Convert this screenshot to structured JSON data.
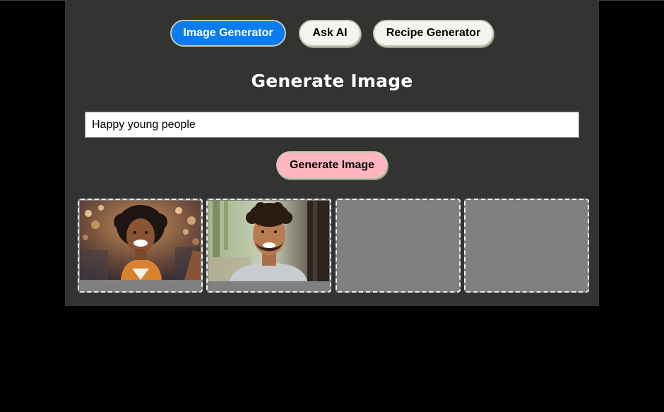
{
  "nav": {
    "items": [
      {
        "label": "Image Generator",
        "active": true
      },
      {
        "label": "Ask AI",
        "active": false
      },
      {
        "label": "Recipe Generator",
        "active": false
      }
    ]
  },
  "main": {
    "title": "Generate Image",
    "prompt": {
      "value": "Happy young people",
      "placeholder": ""
    },
    "generate_button_label": "Generate Image"
  },
  "gallery": {
    "slots": [
      {
        "state": "filled",
        "image": "portrait-smiling-woman-selfie"
      },
      {
        "state": "filled",
        "image": "portrait-smiling-man-curly-hair"
      },
      {
        "state": "empty",
        "image": ""
      },
      {
        "state": "empty",
        "image": ""
      }
    ]
  },
  "colors": {
    "page_background": "#000000",
    "panel_background": "#333331",
    "active_button": "#0a7cf0",
    "inactive_button": "#f4f4f0",
    "generate_button": "#ffb6c1",
    "slot_placeholder": "#808080"
  }
}
